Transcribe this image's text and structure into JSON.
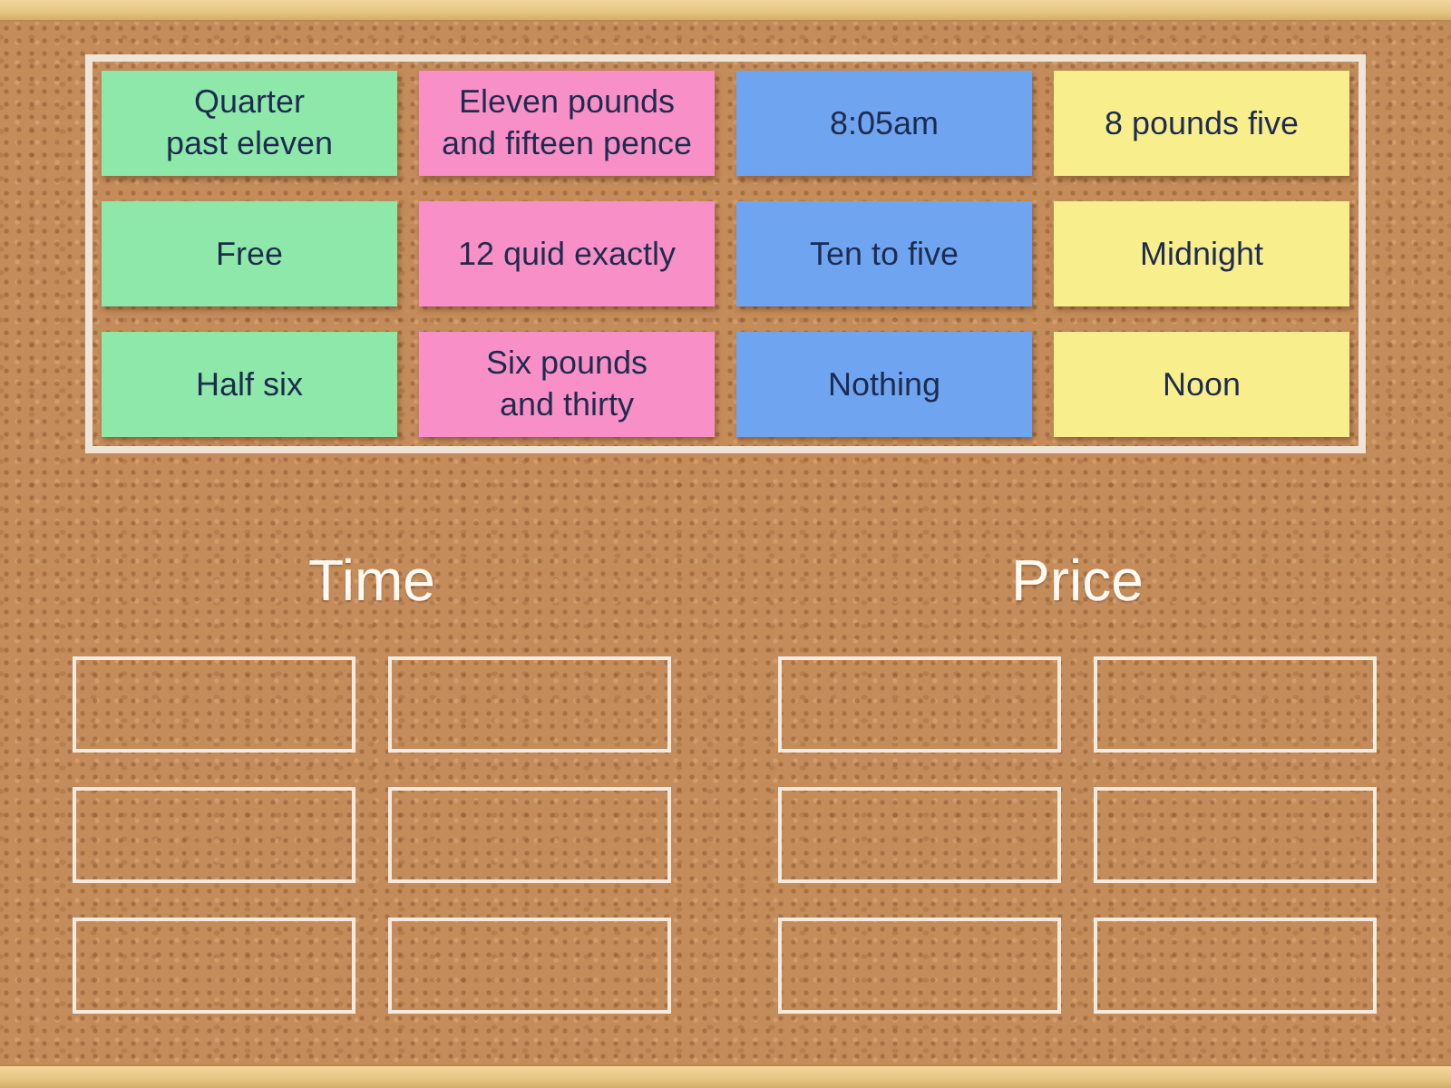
{
  "board": {
    "notes": [
      {
        "label": "Quarter\npast eleven",
        "color": "#8ee8aa"
      },
      {
        "label": "Eleven pounds\nand fifteen pence",
        "color": "#f98fc7"
      },
      {
        "label": "8:05am",
        "color": "#6fa5f0"
      },
      {
        "label": "8 pounds five",
        "color": "#f8ee8c"
      },
      {
        "label": "Free",
        "color": "#8ee8aa"
      },
      {
        "label": "12 quid exactly",
        "color": "#f98fc7"
      },
      {
        "label": "Ten to five",
        "color": "#6fa5f0"
      },
      {
        "label": "Midnight",
        "color": "#f8ee8c"
      },
      {
        "label": "Half six",
        "color": "#8ee8aa"
      },
      {
        "label": "Six pounds\nand thirty",
        "color": "#f98fc7"
      },
      {
        "label": "Nothing",
        "color": "#6fa5f0"
      },
      {
        "label": "Noon",
        "color": "#f8ee8c"
      }
    ]
  },
  "groups": [
    {
      "title": "Time"
    },
    {
      "title": "Price"
    }
  ]
}
